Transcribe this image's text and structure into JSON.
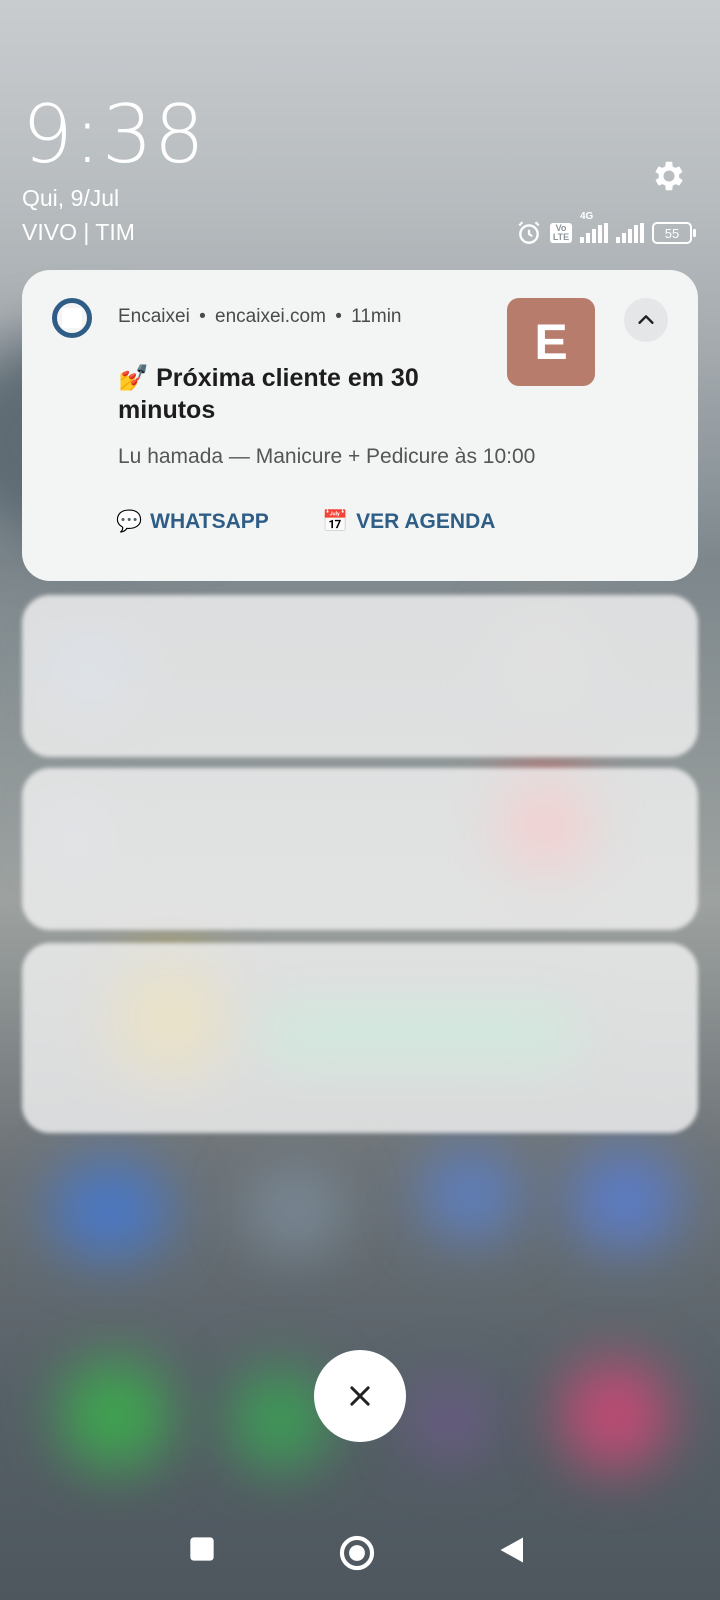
{
  "status": {
    "time": "9:38",
    "date": "Qui, 9/Jul",
    "carrier": "VIVO | TIM",
    "network_tag": "4G",
    "volte_tag": "Vo LTE",
    "battery": "55"
  },
  "notification": {
    "app_name": "Encaixei",
    "separator1": "•",
    "domain": "encaixei.com",
    "separator2": "•",
    "time_ago": "11min",
    "thumb_letter": "E",
    "title_emoji": "💅",
    "title": "Próxima cliente em 30 minutos",
    "body": "Lu hamada — Manicure + Pedicure às 10:00",
    "actions": [
      {
        "emoji": "💬",
        "label": "WHATSAPP"
      },
      {
        "emoji": "📅",
        "label": "VER AGENDA"
      }
    ],
    "accent": "#2e5e86",
    "thumb_color": "#b77c6c"
  }
}
